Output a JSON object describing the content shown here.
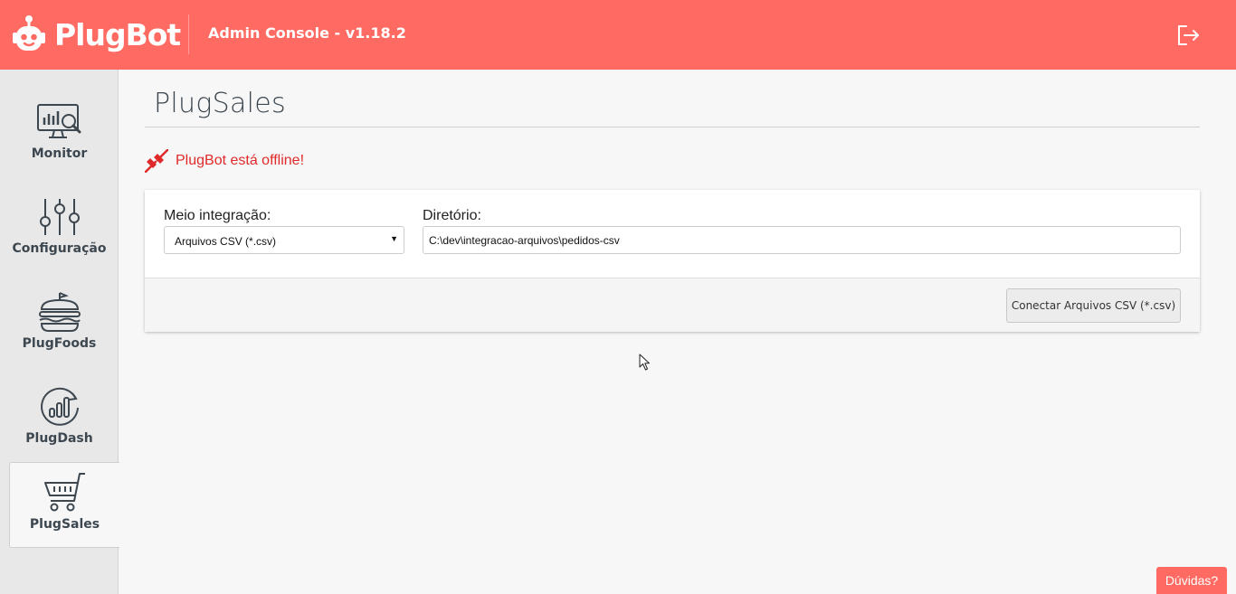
{
  "header": {
    "brand": "PlugBot",
    "app_title": "Admin Console - v1.18.2",
    "logout_icon": "logout-icon"
  },
  "sidebar": {
    "items": [
      {
        "label": "Monitor",
        "icon": "monitor-chart-icon",
        "active": false
      },
      {
        "label": "Configuração",
        "icon": "sliders-icon",
        "active": false
      },
      {
        "label": "PlugFoods",
        "icon": "burger-icon",
        "active": false
      },
      {
        "label": "PlugDash",
        "icon": "dashboard-chart-icon",
        "active": false
      },
      {
        "label": "PlugSales",
        "icon": "shopping-cart-icon",
        "active": true
      }
    ]
  },
  "main": {
    "title": "PlugSales",
    "status": {
      "text": "PlugBot está offline!",
      "color": "#e02a2a",
      "icon": "disconnected-plug-icon"
    },
    "form": {
      "integration_label": "Meio integração:",
      "integration_value": "Arquivos CSV (*.csv)",
      "directory_label": "Diretório:",
      "directory_value": "C:\\dev\\integracao-arquivos\\pedidos-csv",
      "connect_button": "Conectar Arquivos CSV (*.csv)"
    }
  },
  "help_button": "Dúvidas?",
  "colors": {
    "brand": "#ff6b63",
    "sidebar": "#e8e8e8",
    "text_dark": "#3d4750"
  }
}
